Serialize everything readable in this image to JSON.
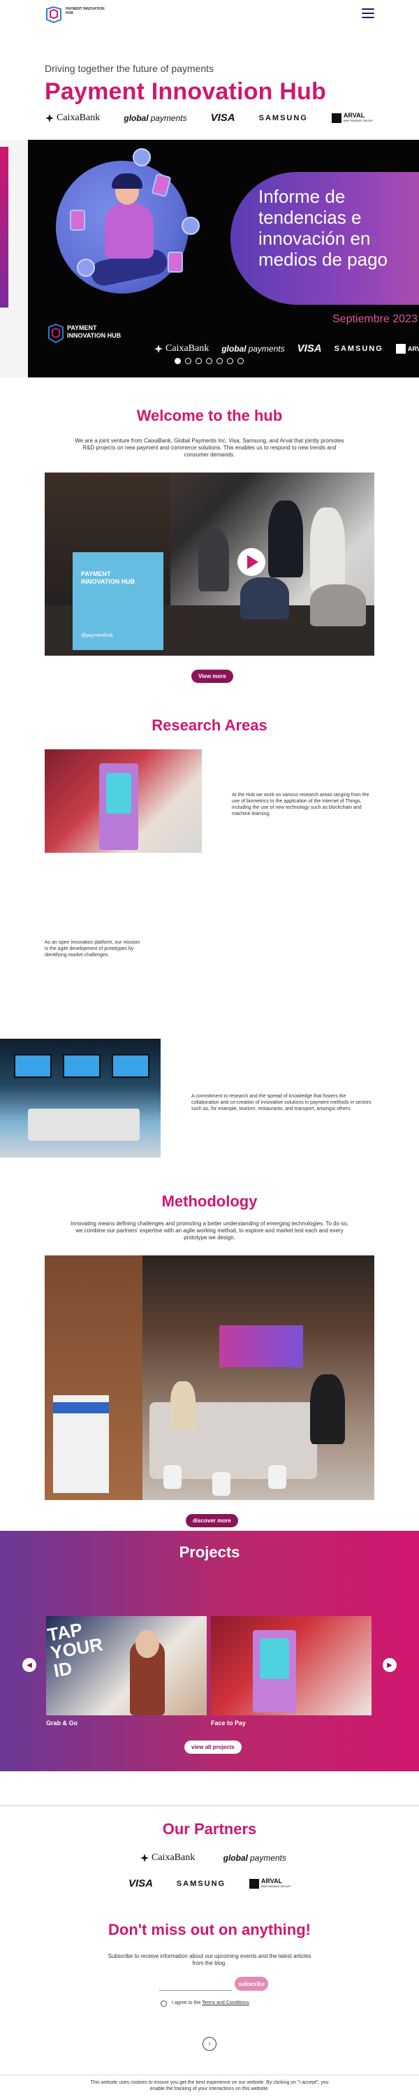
{
  "header": {
    "logo_text": "PAYMENT INNOVATION HUB",
    "menu_icon": "hamburger-menu-icon"
  },
  "intro": {
    "tagline": "Driving together the future of payments",
    "title": "Payment Innovation Hub"
  },
  "partners_top": {
    "caixabank": "CaixaBank",
    "globalpayments_bold": "global",
    "globalpayments_rest": "payments",
    "visa": "VISA",
    "samsung": "SAMSUNG",
    "arval": "ARVAL",
    "arval_sub": "BNP PARIBAS GROUP"
  },
  "hero": {
    "headline": "Informe de tendencias e innovación en medios de pago",
    "date": "Septiembre 2023",
    "hub_logo_text": "PAYMENT INNOVATION HUB",
    "logos": {
      "caixabank": "CaixaBank",
      "globalpayments_bold": "global",
      "globalpayments_rest": "payments",
      "visa": "VISA",
      "samsung": "SAMSUNG",
      "arval": "ARVAL"
    },
    "slides_count": 7,
    "active_slide": 1
  },
  "welcome": {
    "title": "Welcome to the hub",
    "text": "We are a joint venture from CaixaBank, Global Payments Inc, Visa, Samsung, and Arval that jointly promotes R&D projects on new payment and commerce solutions. This enables us to respond to new trends and consumer demands.",
    "panel_text": "PAYMENT INNOVATION HUB",
    "panel_handle": "@paymenthub",
    "button": "View more"
  },
  "research": {
    "title": "Research Areas",
    "block1": "At the Hub we work on various research areas ranging from the use of biometrics to the application of the Internet of Things, including the use of new technology such as blockchain and machine learning.",
    "block2": "As an open innovation platform, our mission is the agile development of prototypes by identifying market challenges.",
    "block3": "A commitment to research and the spread of knowledge that fosters the collaboration and co-creation of innovative solutions in payment methods in sectors such as, for example, tourism, restaurants, and transport, amongst others."
  },
  "methodology": {
    "title": "Methodology",
    "text": "Innovating means defining challenges and promoting a better understanding of emerging technologies. To do so, we combine our partners' expertise with an agile working method, to explore and market test each and every prototype we design.",
    "button": "discover more"
  },
  "projects": {
    "title": "Projects",
    "items": [
      {
        "label": "Grab & Go",
        "card_text": "TAP YOUR ID"
      },
      {
        "label": "Face to Pay"
      }
    ],
    "button": "view all projects",
    "prev_icon": "chevron-left-icon",
    "next_icon": "chevron-right-icon"
  },
  "our_partners": {
    "title": "Our Partners",
    "caixabank": "CaixaBank",
    "globalpayments_bold": "global",
    "globalpayments_rest": "payments",
    "visa": "VISA",
    "samsung": "SAMSUNG",
    "arval": "ARVAL",
    "arval_sub": "BNP PARIBAS GROUP"
  },
  "newsletter": {
    "title": "Don't miss out on anything!",
    "text": "Subscribe to receive information about our upcoming events and the latest articles from the blog.",
    "input_placeholder": "",
    "button": "subscribe",
    "agree_prefix": "I agree to the",
    "agree_link": "Terms and Conditions"
  },
  "cookie": {
    "text": "This website uses cookies to ensure you get the best experience on our website. By clicking on \"I accept\", you enable the tracking of your interactions on this website."
  },
  "colors": {
    "brand": "#d0176e",
    "button": "#8a1458",
    "navy": "#1b1f5c"
  }
}
